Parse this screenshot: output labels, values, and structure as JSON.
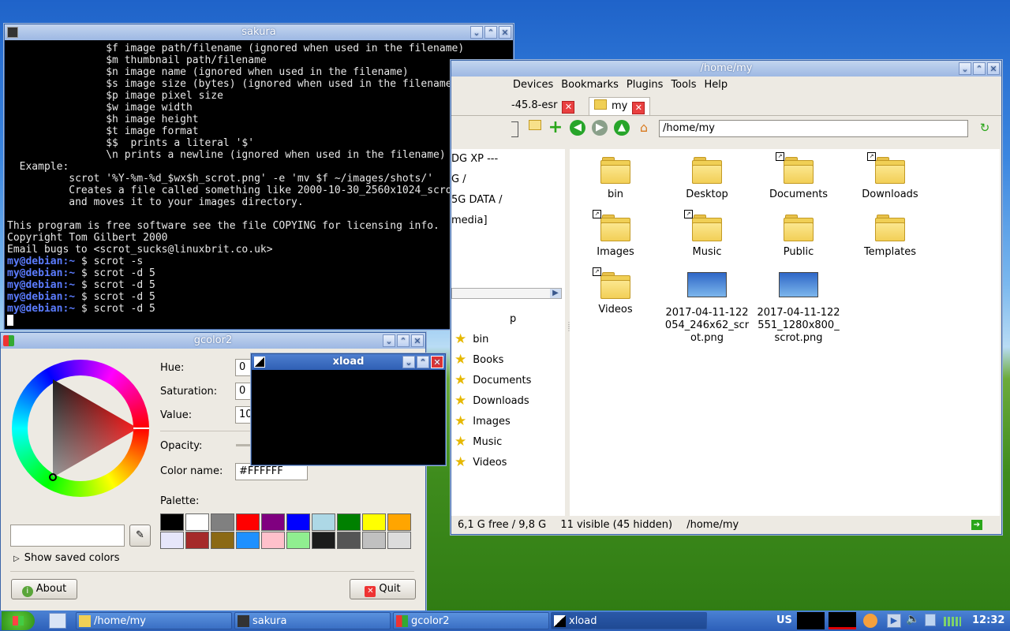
{
  "terminal": {
    "title": "sakura",
    "lines": [
      "                $f image path/filename (ignored when used in the filename)",
      "                $m thumbnail path/filename",
      "                $n image name (ignored when used in the filename)",
      "                $s image size (bytes) (ignored when used in the filename)",
      "                $p image pixel size",
      "                $w image width",
      "                $h image height",
      "                $t image format",
      "                $$  prints a literal '$'",
      "                \\n prints a newline (ignored when used in the filename)",
      "  Example:",
      "          scrot '%Y-%m-%d_$wx$h_scrot.png' -e 'mv $f ~/images/shots/'",
      "          Creates a file called something like 2000-10-30_2560x1024_scrot.png",
      "          and moves it to your images directory.",
      "",
      "This program is free software see the file COPYING for licensing info.",
      "Copyright Tom Gilbert 2000",
      "Email bugs to <scrot_sucks@linuxbrit.co.uk>"
    ],
    "prompt": "my@debian:~",
    "commands": [
      "$ scrot -s",
      "$ scrot -d 5",
      "$ scrot -d 5",
      "$ scrot -d 5",
      "$ scrot -d 5"
    ]
  },
  "filemanager": {
    "title": "/home/my",
    "menu": [
      "Devices",
      "Bookmarks",
      "Plugins",
      "Tools",
      "Help"
    ],
    "tabs": [
      {
        "label": "-45.8-esr"
      },
      {
        "label": "my"
      }
    ],
    "path": "/home/my",
    "devices": [
      "DG XP ---",
      "G /",
      "5G DATA /",
      "media]"
    ],
    "bookmarks": [
      "bin",
      "Books",
      "Documents",
      "Downloads",
      "Images",
      "Music",
      "Videos"
    ],
    "bookmark_partial": "p",
    "files": [
      {
        "name": "bin",
        "type": "folder",
        "link": false
      },
      {
        "name": "Desktop",
        "type": "folder",
        "link": false
      },
      {
        "name": "Documents",
        "type": "folder",
        "link": true
      },
      {
        "name": "Downloads",
        "type": "folder",
        "link": true
      },
      {
        "name": "Images",
        "type": "folder",
        "link": true
      },
      {
        "name": "Music",
        "type": "folder",
        "link": true
      },
      {
        "name": "Public",
        "type": "folder",
        "link": false
      },
      {
        "name": "Templates",
        "type": "folder",
        "link": false
      },
      {
        "name": "Videos",
        "type": "folder",
        "link": true
      },
      {
        "name": "2017-04-11-122054_246x62_scrot.png",
        "type": "image",
        "label_lines": [
          "2017-04-11-122",
          "054_246x62_scr",
          "ot.png"
        ]
      },
      {
        "name": "2017-04-11-122551_1280x800_scrot.png",
        "type": "image",
        "label_lines": [
          "2017-04-11-122",
          "551_1280x800_",
          "scrot.png"
        ]
      }
    ],
    "status": {
      "free": "6,1 G free / 9,8 G",
      "visible": "11 visible (45 hidden)",
      "path": "/home/my"
    }
  },
  "gcolor": {
    "title": "gcolor2",
    "hue_label": "Hue:",
    "hue": "0",
    "sat_label": "Saturation:",
    "sat": "0",
    "val_label": "Value:",
    "val": "10",
    "opacity_label": "Opacity:",
    "colorname_label": "Color name:",
    "colorname": "#FFFFFF",
    "palette_label": "Palette:",
    "palette": [
      "#000000",
      "#ffffff",
      "#808080",
      "#ff0000",
      "#800080",
      "#0000ff",
      "#add8e6",
      "#008000",
      "#ffff00",
      "#ffa500",
      "#e6e6fa",
      "#a52a2a",
      "#8b6914",
      "#1e90ff",
      "#ffc0cb",
      "#90ee90",
      "#1c1c1c",
      "#555555",
      "#c0c0c0",
      "#dcdcdc"
    ],
    "show_saved": "Show saved colors",
    "about": "About",
    "quit": "Quit"
  },
  "xload": {
    "title": "xload"
  },
  "taskbar": {
    "items": [
      "/home/my",
      "sakura",
      "gcolor2",
      "xload"
    ],
    "kbd": "US",
    "clock": "12:32"
  }
}
